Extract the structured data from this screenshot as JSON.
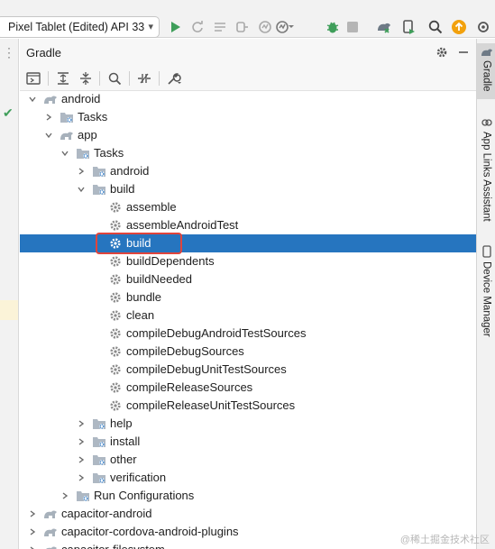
{
  "toolbar": {
    "device_selector": "Pixel Tablet (Edited) API 33",
    "icons": [
      "run-icon",
      "apply-changes-icon",
      "apply-code-changes-icon",
      "attach-debugger-icon",
      "profile-icon",
      "debug-icon",
      "stop-icon",
      "sync-gradle-icon",
      "device-manager-icon",
      "search-icon",
      "update-icon"
    ],
    "accent": "#3f9e5a"
  },
  "panel": {
    "title": "Gradle",
    "header_icons": [
      "gear-icon",
      "minimize-icon"
    ],
    "toolbar_icons": [
      "execute-task-icon",
      "expand-all-icon",
      "collapse-all-icon",
      "analyze-dependencies-icon",
      "toggle-offline-icon",
      "build-settings-icon"
    ]
  },
  "tree": [
    {
      "label": "android",
      "icon": "gradle-elephant-icon",
      "expanded": true
    },
    {
      "label": "Tasks",
      "icon": "folder-gear-icon",
      "expanded": false
    },
    {
      "label": "app",
      "icon": "gradle-elephant-icon",
      "expanded": true
    },
    {
      "label": "Tasks",
      "icon": "folder-gear-icon",
      "expanded": true
    },
    {
      "label": "android",
      "icon": "folder-gear-icon",
      "expanded": false
    },
    {
      "label": "build",
      "icon": "folder-gear-icon",
      "expanded": true
    },
    {
      "label": "assemble",
      "icon": "gear-icon"
    },
    {
      "label": "assembleAndroidTest",
      "icon": "gear-icon"
    },
    {
      "label": "build",
      "icon": "gear-icon",
      "selected": true
    },
    {
      "label": "buildDependents",
      "icon": "gear-icon"
    },
    {
      "label": "buildNeeded",
      "icon": "gear-icon"
    },
    {
      "label": "bundle",
      "icon": "gear-icon"
    },
    {
      "label": "clean",
      "icon": "gear-icon"
    },
    {
      "label": "compileDebugAndroidTestSources",
      "icon": "gear-icon"
    },
    {
      "label": "compileDebugSources",
      "icon": "gear-icon"
    },
    {
      "label": "compileDebugUnitTestSources",
      "icon": "gear-icon"
    },
    {
      "label": "compileReleaseSources",
      "icon": "gear-icon"
    },
    {
      "label": "compileReleaseUnitTestSources",
      "icon": "gear-icon"
    },
    {
      "label": "help",
      "icon": "folder-gear-icon",
      "expanded": false
    },
    {
      "label": "install",
      "icon": "folder-gear-icon",
      "expanded": false
    },
    {
      "label": "other",
      "icon": "folder-gear-icon",
      "expanded": false
    },
    {
      "label": "verification",
      "icon": "folder-gear-icon",
      "expanded": false
    },
    {
      "label": "Run Configurations",
      "icon": "folder-gear-icon",
      "expanded": false
    },
    {
      "label": "capacitor-android",
      "icon": "gradle-elephant-icon",
      "expanded": false
    },
    {
      "label": "capacitor-cordova-android-plugins",
      "icon": "gradle-elephant-icon",
      "expanded": false
    },
    {
      "label": "capacitor-filesystem",
      "icon": "gradle-elephant-icon",
      "expanded": false
    }
  ],
  "right_tabs": [
    {
      "label": "Gradle",
      "icon": "gradle-elephant-icon",
      "active": true
    },
    {
      "label": "App Links Assistant",
      "icon": "link-icon"
    },
    {
      "label": "Device Manager",
      "icon": "device-icon"
    }
  ],
  "colors": {
    "selection": "#2675bf",
    "highlight_border": "#e0443c"
  },
  "watermark": "@稀土掘金技术社区"
}
